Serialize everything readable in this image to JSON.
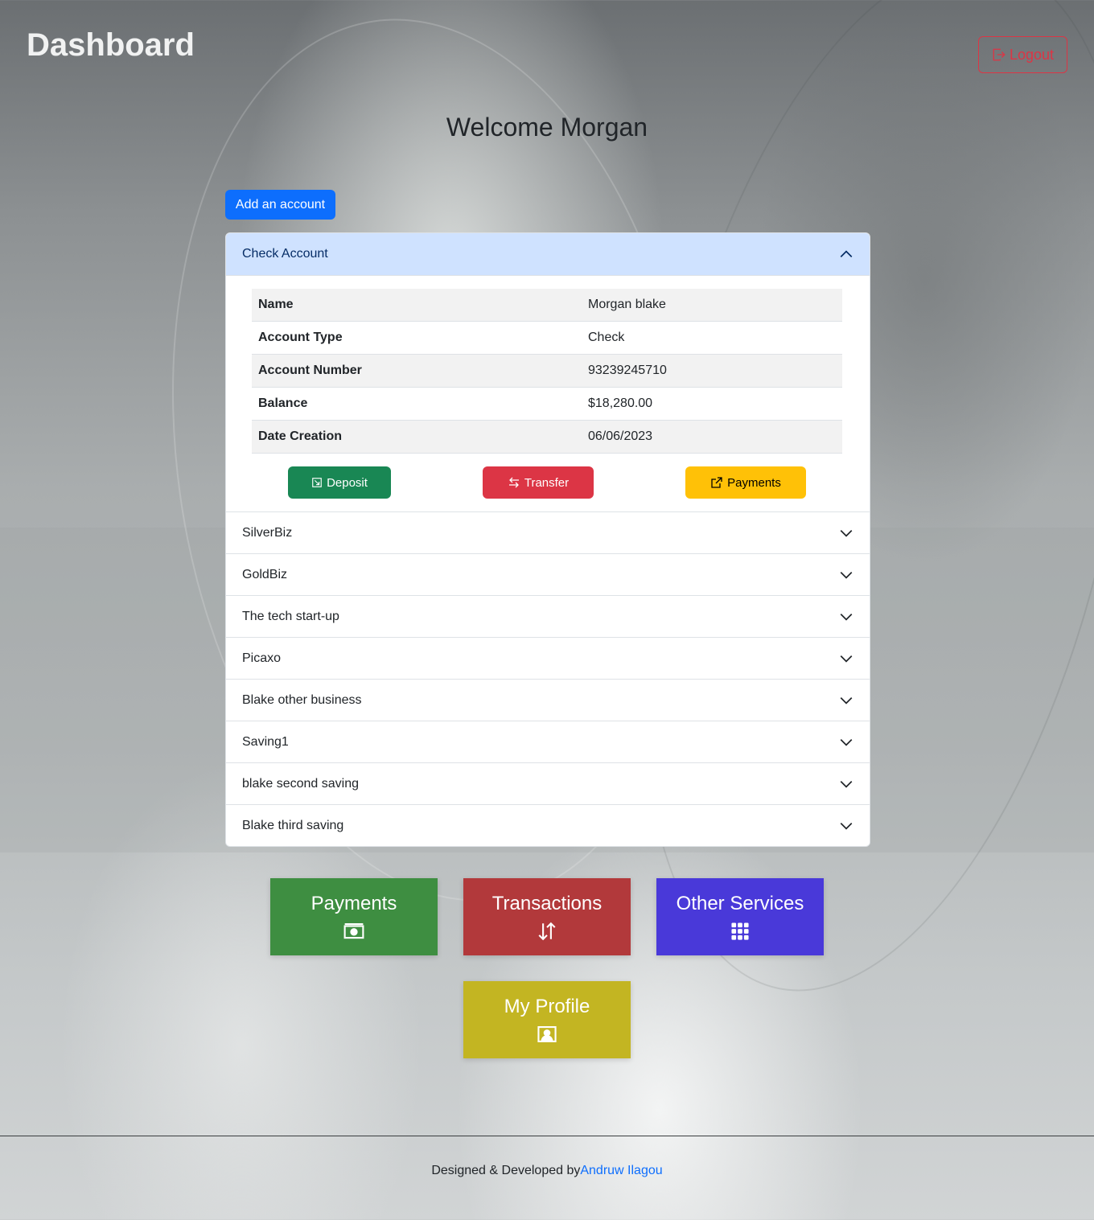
{
  "header": {
    "title": "Dashboard",
    "logout_label": "Logout"
  },
  "welcome_text": "Welcome Morgan",
  "add_account_label": "Add an account",
  "accounts": [
    {
      "name": "Check Account",
      "expanded": true,
      "details": [
        {
          "label": "Name",
          "value": "Morgan blake"
        },
        {
          "label": "Account Type",
          "value": "Check"
        },
        {
          "label": "Account Number",
          "value": "93239245710"
        },
        {
          "label": "Balance",
          "value": "$18,280.00"
        },
        {
          "label": "Date Creation",
          "value": "06/06/2023"
        }
      ],
      "actions": {
        "deposit": "Deposit",
        "transfer": "Transfer",
        "payments": "Payments"
      }
    },
    {
      "name": "SilverBiz",
      "expanded": false
    },
    {
      "name": "GoldBiz",
      "expanded": false
    },
    {
      "name": "The tech start-up",
      "expanded": false
    },
    {
      "name": "Picaxo",
      "expanded": false
    },
    {
      "name": "Blake other business",
      "expanded": false
    },
    {
      "name": "Saving1",
      "expanded": false
    },
    {
      "name": "blake second saving",
      "expanded": false
    },
    {
      "name": "Blake third saving",
      "expanded": false
    }
  ],
  "tiles": {
    "payments": "Payments",
    "transactions": "Transactions",
    "other_services": "Other Services",
    "my_profile": "My Profile"
  },
  "footer": {
    "prefix": "Designed & Developed by",
    "author": "Andruw Ilagou"
  },
  "colors": {
    "primary": "#0d6efd",
    "success": "#198754",
    "danger": "#dc3545",
    "warning": "#ffc107",
    "tile_payments": "#3e8e41",
    "tile_transactions": "#b2393b",
    "tile_services": "#4939d9",
    "tile_profile": "#c3b522"
  }
}
